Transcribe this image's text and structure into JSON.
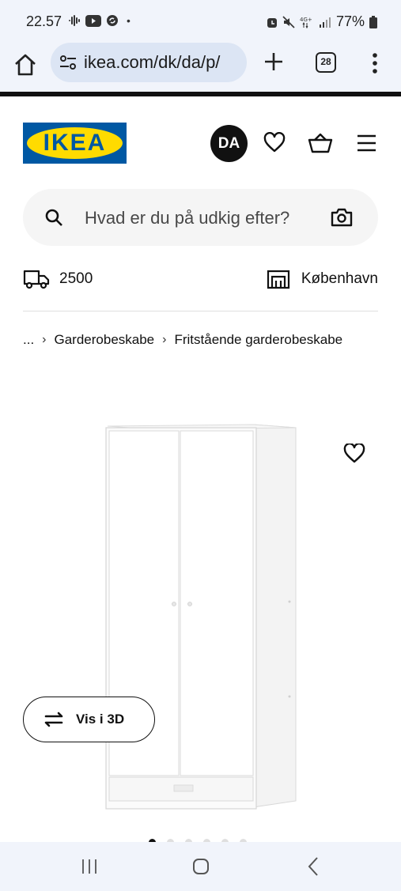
{
  "status_bar": {
    "time": "22.57",
    "battery": "77%"
  },
  "browser": {
    "url": "ikea.com/dk/da/p/",
    "tab_count": "28"
  },
  "header": {
    "logo_text": "IKEA",
    "language": "DA"
  },
  "search": {
    "placeholder": "Hvad er du på udkig efter?"
  },
  "delivery": {
    "postcode": "2500",
    "store": "København"
  },
  "breadcrumb": {
    "items": [
      "...",
      "Garderobeskabe",
      "Fritstående garderobeskabe"
    ]
  },
  "product": {
    "view_3d_label": "Vis i 3D",
    "image_count": 6,
    "active_image": 0
  },
  "colors": {
    "ikea_blue": "#0058a3",
    "ikea_yellow": "#ffdb00",
    "browser_bg": "#f1f4fb",
    "url_bg": "#dce5f4"
  }
}
